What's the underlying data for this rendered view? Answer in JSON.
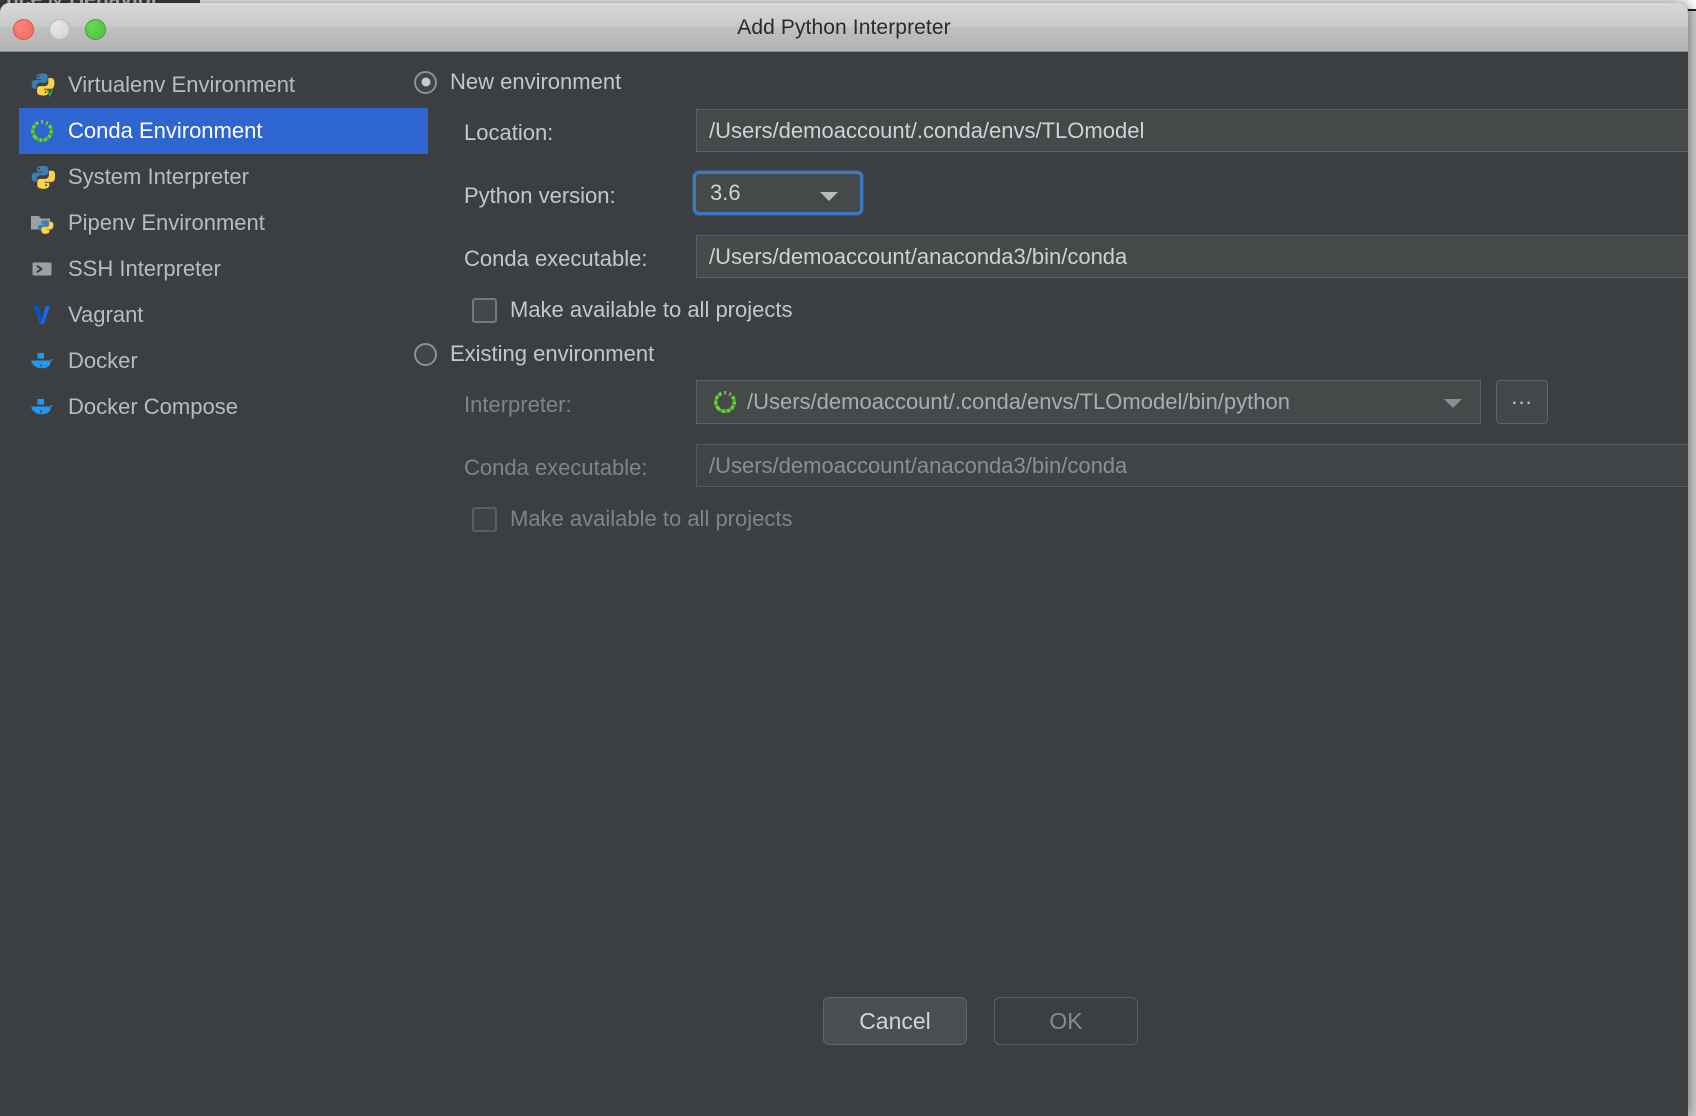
{
  "background": {
    "behind_window_title": "nce & Behavior"
  },
  "titlebar": {
    "title": "Add Python Interpreter",
    "traffic_lights": {
      "close": "close-button",
      "minimize": "minimize-button",
      "maximize": "maximize-button"
    }
  },
  "sidebar": {
    "items": [
      {
        "label": "Virtualenv Environment",
        "icon": "python-venv-icon",
        "selected": false
      },
      {
        "label": "Conda Environment",
        "icon": "conda-icon",
        "selected": true
      },
      {
        "label": "System Interpreter",
        "icon": "python-icon",
        "selected": false
      },
      {
        "label": "Pipenv Environment",
        "icon": "pipenv-folder-python-icon",
        "selected": false
      },
      {
        "label": "SSH Interpreter",
        "icon": "terminal-prompt-icon",
        "selected": false
      },
      {
        "label": "Vagrant",
        "icon": "vagrant-v-icon",
        "selected": false
      },
      {
        "label": "Docker",
        "icon": "docker-whale-icon",
        "selected": false
      },
      {
        "label": "Docker Compose",
        "icon": "docker-whale-icon",
        "selected": false
      }
    ]
  },
  "main": {
    "new_environment": {
      "radio_label": "New environment",
      "selected": true,
      "location": {
        "label": "Location:",
        "value": "/Users/demoaccount/.conda/envs/TLOmodel",
        "browse_icon": "folder-icon"
      },
      "python_version": {
        "label": "Python version:",
        "value": "3.6",
        "caret_icon": "chevron-down-icon",
        "focused": true
      },
      "conda_executable": {
        "label": "Conda executable:",
        "value": "/Users/demoaccount/anaconda3/bin/conda",
        "browse_icon": "folder-icon"
      },
      "make_available": {
        "label": "Make available to all projects",
        "checked": false
      }
    },
    "existing_environment": {
      "radio_label": "Existing environment",
      "selected": false,
      "interpreter": {
        "label": "Interpreter:",
        "value": "/Users/demoaccount/.conda/envs/TLOmodel/bin/python",
        "item_icon": "conda-icon",
        "caret_icon": "chevron-down-icon",
        "browse_label": "..."
      },
      "conda_executable": {
        "label": "Conda executable:",
        "value": "/Users/demoaccount/anaconda3/bin/conda",
        "browse_icon": "folder-icon"
      },
      "make_available": {
        "label": "Make available to all projects",
        "checked": false
      }
    }
  },
  "footer": {
    "cancel_label": "Cancel",
    "ok_label": "OK",
    "ok_enabled": false
  },
  "colors": {
    "dialog_bg": "#3c3f41",
    "selection_blue": "#2f65d0",
    "focus_blue": "#3e78bf",
    "conda_green": "#43b02a",
    "python_blue": "#3b7fb0",
    "python_yellow": "#ffd343",
    "docker_blue": "#2496ed",
    "vagrant_blue": "#1868f2"
  }
}
